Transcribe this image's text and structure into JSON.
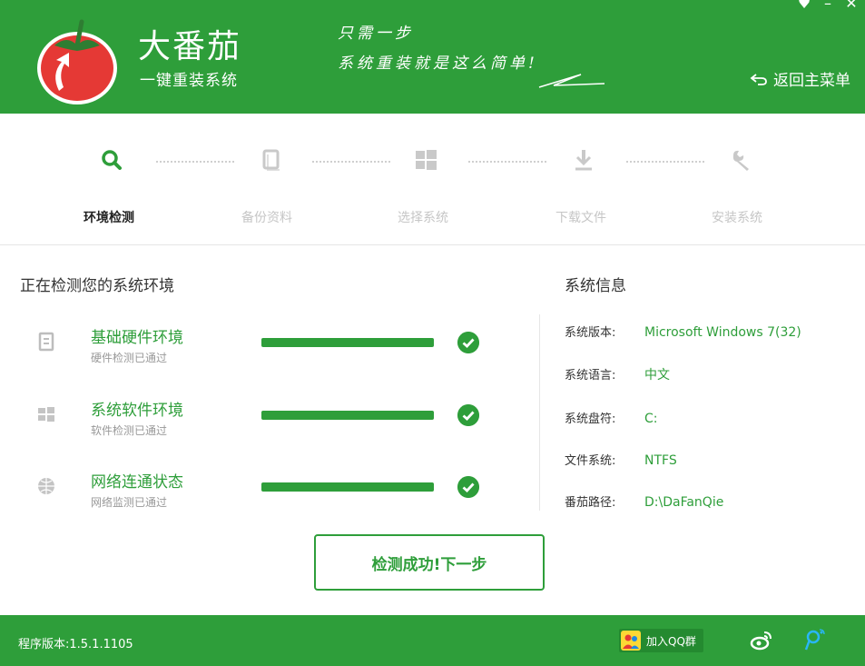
{
  "header": {
    "brand_title": "大番茄",
    "brand_subtitle": "一键重装系统",
    "slogan_line1": "只需一步",
    "slogan_line2": "系统重装就是这么简单!",
    "back_label": "返回主菜单",
    "colors": {
      "primary": "#2e9e3a",
      "tomato_red": "#e53935",
      "leaf": "#2e7d32"
    }
  },
  "steps": [
    {
      "label": "环境检测",
      "icon": "search-icon",
      "active": true
    },
    {
      "label": "备份资料",
      "icon": "copy-icon",
      "active": false
    },
    {
      "label": "选择系统",
      "icon": "windows-icon",
      "active": false
    },
    {
      "label": "下载文件",
      "icon": "download-icon",
      "active": false
    },
    {
      "label": "安装系统",
      "icon": "wrench-icon",
      "active": false
    }
  ],
  "detection": {
    "title": "正在检测您的系统环境",
    "items": [
      {
        "name": "基础硬件环境",
        "status": "硬件检测已通过",
        "icon": "hardware-icon",
        "progress": 1.0
      },
      {
        "name": "系统软件环境",
        "status": "软件检测已通过",
        "icon": "windows-icon",
        "progress": 1.0
      },
      {
        "name": "网络连通状态",
        "status": "网络监测已通过",
        "icon": "globe-icon",
        "progress": 1.0
      }
    ]
  },
  "system_info": {
    "title": "系统信息",
    "rows": [
      {
        "key": "系统版本:",
        "value": "Microsoft Windows 7(32)"
      },
      {
        "key": "系统语言:",
        "value": "中文"
      },
      {
        "key": "系统盘符:",
        "value": "C:"
      },
      {
        "key": "文件系统:",
        "value": "NTFS"
      },
      {
        "key": "番茄路径:",
        "value": "D:\\DaFanQie"
      }
    ]
  },
  "next_button_label": "检测成功!下一步",
  "footer": {
    "version": "程序版本:1.5.1.1105",
    "qq_group_label": "加入QQ群"
  }
}
